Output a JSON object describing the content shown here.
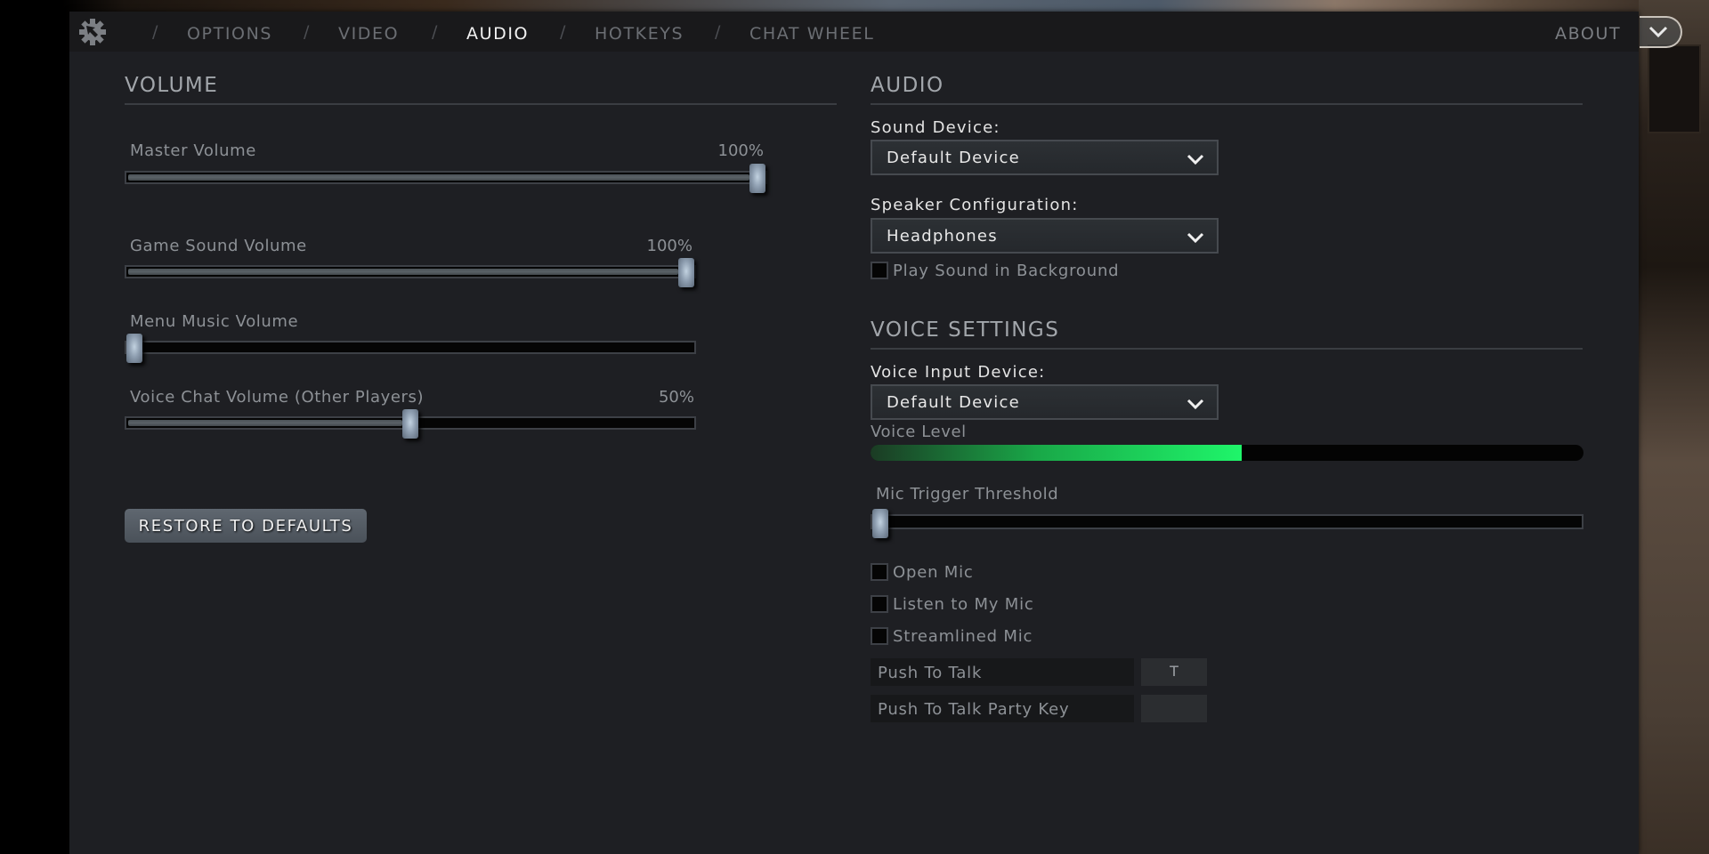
{
  "nav": {
    "tabs": [
      {
        "label": "OPTIONS",
        "active": false
      },
      {
        "label": "VIDEO",
        "active": false
      },
      {
        "label": "AUDIO",
        "active": true
      },
      {
        "label": "HOTKEYS",
        "active": false
      },
      {
        "label": "CHAT WHEEL",
        "active": false
      }
    ],
    "separator": "/",
    "about_label": "ABOUT",
    "settings_icon": "gear-icon",
    "collapse_icon": "chevron-down-icon"
  },
  "volume": {
    "heading": "VOLUME",
    "sliders": [
      {
        "label": "Master Volume",
        "value_text": "100%",
        "value": 1.0
      },
      {
        "label": "Game Sound Volume",
        "value_text": "100%",
        "value": 1.0
      },
      {
        "label": "Menu Music Volume",
        "value_text": "",
        "value": 0.0
      },
      {
        "label": "Voice Chat Volume (Other Players)",
        "value_text": "50%",
        "value": 0.5
      }
    ],
    "restore_label": "RESTORE TO DEFAULTS"
  },
  "audio": {
    "heading": "AUDIO",
    "sound_device": {
      "label": "Sound Device:",
      "value": "Default Device"
    },
    "speaker_config": {
      "label": "Speaker Configuration:",
      "value": "Headphones"
    },
    "play_in_background": {
      "label": "Play Sound in Background",
      "checked": false
    }
  },
  "voice": {
    "heading": "VOICE SETTINGS",
    "input_device": {
      "label": "Voice Input Device:",
      "value": "Default Device"
    },
    "voice_level": {
      "label": "Voice Level",
      "value": 0.52
    },
    "mic_threshold": {
      "label": "Mic Trigger Threshold",
      "value": 0.0
    },
    "checkboxes": [
      {
        "label": "Open Mic",
        "checked": false
      },
      {
        "label": "Listen to My Mic",
        "checked": false
      },
      {
        "label": "Streamlined Mic",
        "checked": false
      }
    ],
    "keybinds": [
      {
        "label": "Push To Talk",
        "key": "T"
      },
      {
        "label": "Push To Talk Party Key",
        "key": ""
      }
    ]
  },
  "colors": {
    "voice_level_green": "#1ff56a",
    "active_tab": "#f2f2f2",
    "inactive_tab": "#6b6e73"
  }
}
